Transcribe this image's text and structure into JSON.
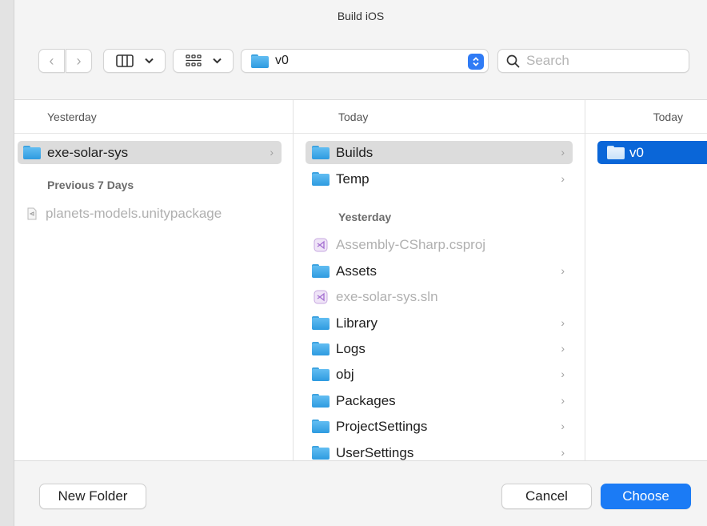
{
  "dialog": {
    "title": "Build iOS"
  },
  "toolbar": {
    "path_label": "v0",
    "search_placeholder": "Search"
  },
  "columns": [
    {
      "header": "Yesterday",
      "sections": [
        {
          "label": "",
          "items": [
            {
              "name": "exe-solar-sys",
              "type": "folder",
              "state": "selected-inactive",
              "has_children": true
            }
          ]
        },
        {
          "label": "Previous 7 Days",
          "items": [
            {
              "name": "planets-models.unitypackage",
              "type": "unitypackage",
              "state": "disabled",
              "has_children": false
            }
          ]
        }
      ]
    },
    {
      "header": "Today",
      "items_today": [
        {
          "name": "Builds",
          "type": "folder",
          "state": "selected-inactive",
          "has_children": true
        },
        {
          "name": "Temp",
          "type": "folder",
          "state": "normal",
          "has_children": true
        }
      ],
      "section_label": "Yesterday",
      "items_yesterday": [
        {
          "name": "Assembly-CSharp.csproj",
          "type": "vs-project",
          "state": "disabled",
          "has_children": false
        },
        {
          "name": "Assets",
          "type": "folder",
          "state": "normal",
          "has_children": true
        },
        {
          "name": "exe-solar-sys.sln",
          "type": "vs-project",
          "state": "disabled",
          "has_children": false
        },
        {
          "name": "Library",
          "type": "folder",
          "state": "normal",
          "has_children": true
        },
        {
          "name": "Logs",
          "type": "folder",
          "state": "normal",
          "has_children": true
        },
        {
          "name": "obj",
          "type": "folder",
          "state": "normal",
          "has_children": true
        },
        {
          "name": "Packages",
          "type": "folder",
          "state": "normal",
          "has_children": true
        },
        {
          "name": "ProjectSettings",
          "type": "folder",
          "state": "normal",
          "has_children": true
        },
        {
          "name": "UserSettings",
          "type": "folder",
          "state": "normal",
          "has_children": true
        }
      ]
    },
    {
      "header": "Today",
      "items": [
        {
          "name": "v0",
          "type": "folder",
          "state": "selected-active",
          "has_children": false
        }
      ]
    }
  ],
  "footer": {
    "new_folder_label": "New Folder",
    "cancel_label": "Cancel",
    "choose_label": "Choose"
  },
  "colors": {
    "accent": "#1b7bf5",
    "selection_active": "#0a66d8",
    "selection_inactive": "#dcdcdc",
    "folder": "#45aeea"
  },
  "disclosure_glyph": "›"
}
